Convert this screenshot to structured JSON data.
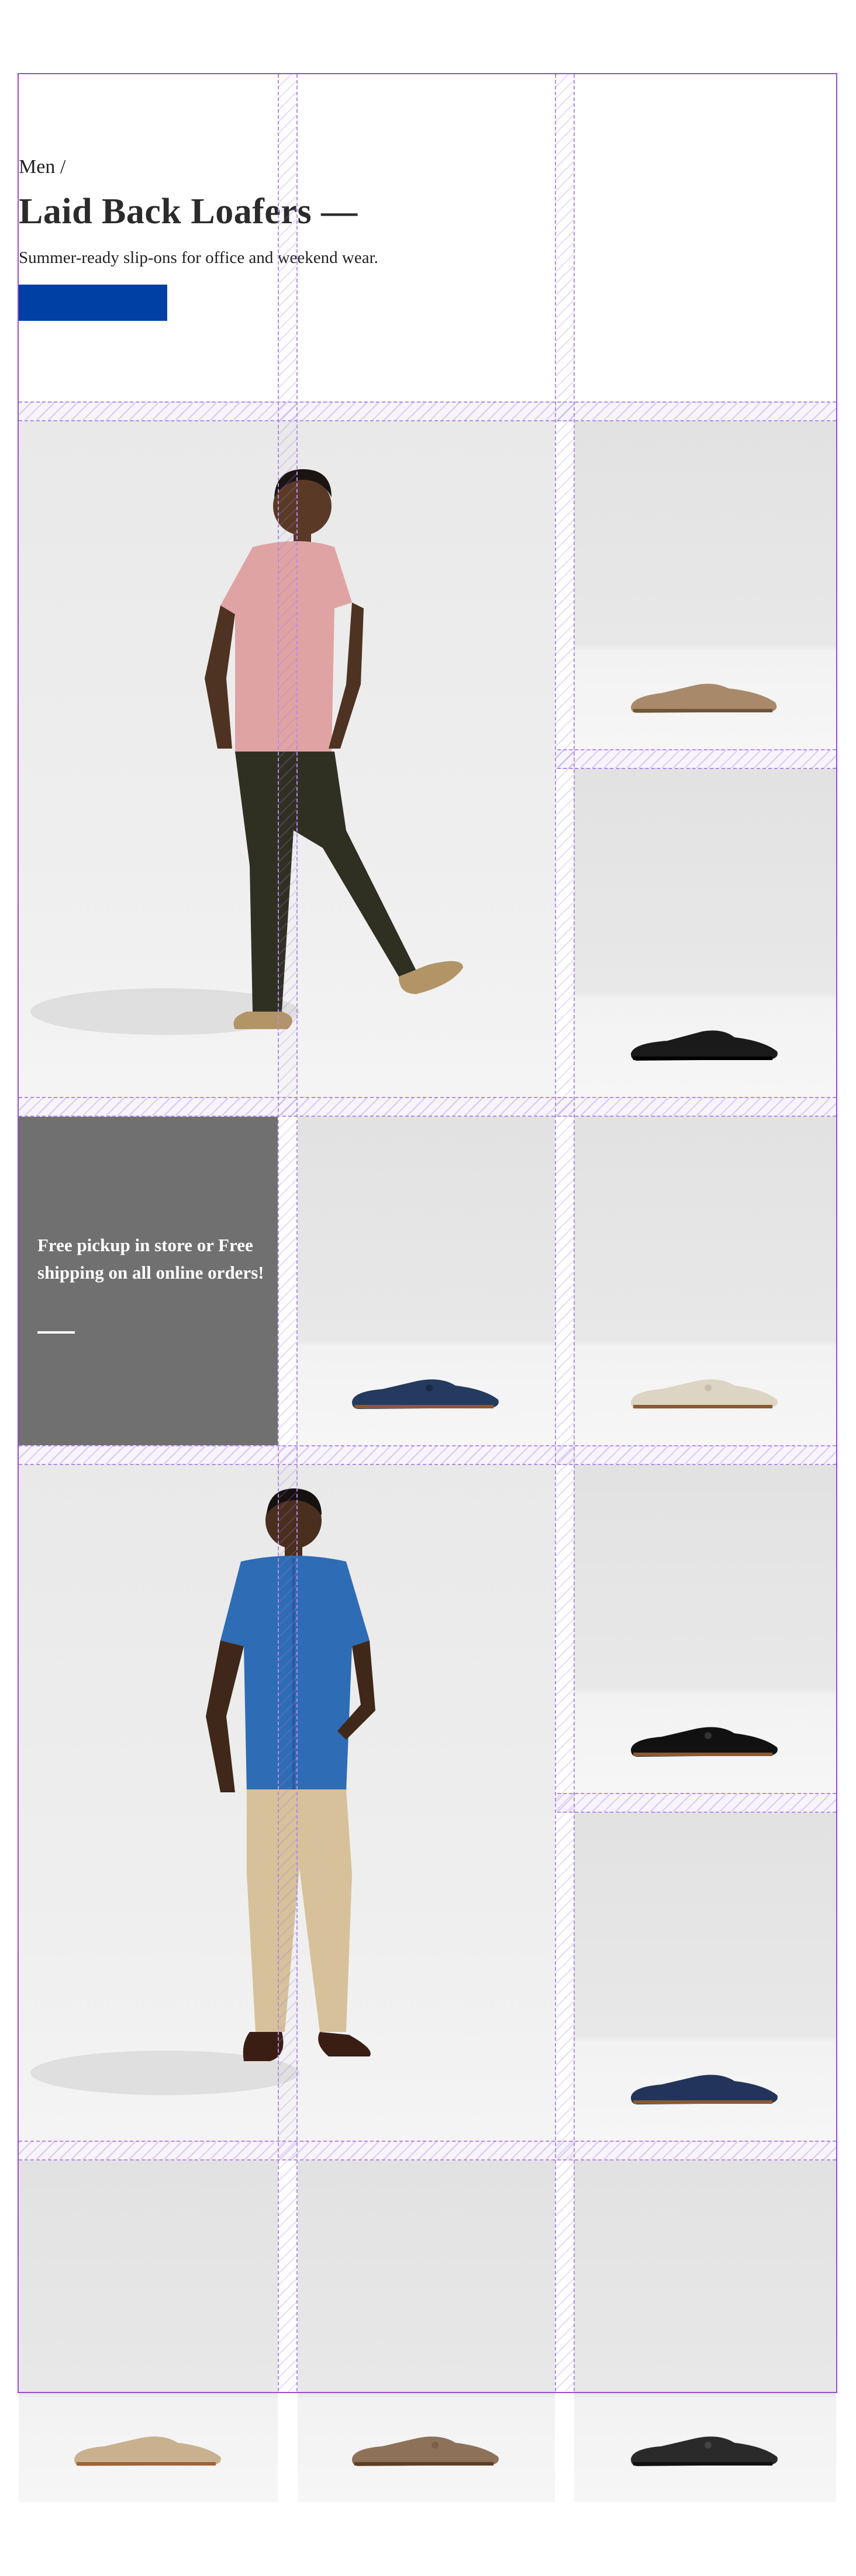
{
  "hero": {
    "breadcrumb": "Men /",
    "title": "Laid Back Loafers —",
    "subtitle": "Summer-ready slip-ons for office and weekend wear.",
    "cta_label": ""
  },
  "promo": {
    "text": "Free pickup in store or Free shipping on all online orders!"
  },
  "colors": {
    "cta": "#003fa3",
    "promo_bg": "#707070",
    "layout_guide": "#9a4ec9"
  },
  "products": [
    {
      "name": "tan suede driving loafer",
      "color": "#a88a6a"
    },
    {
      "name": "black leather loafer",
      "color": "#1a1a1a"
    },
    {
      "name": "navy suede tassel loafer",
      "color": "#243a5e"
    },
    {
      "name": "cream suede tassel loafer",
      "color": "#ddd5c4"
    },
    {
      "name": "black suede tassel loafer",
      "color": "#111111"
    },
    {
      "name": "navy suede loafer",
      "color": "#22345a"
    },
    {
      "name": "beige suede loafer",
      "color": "#c9b18f"
    },
    {
      "name": "taupe suede bit loafer",
      "color": "#8d7259"
    },
    {
      "name": "black suede tassel loafer",
      "color": "#2a2a2a"
    }
  ]
}
